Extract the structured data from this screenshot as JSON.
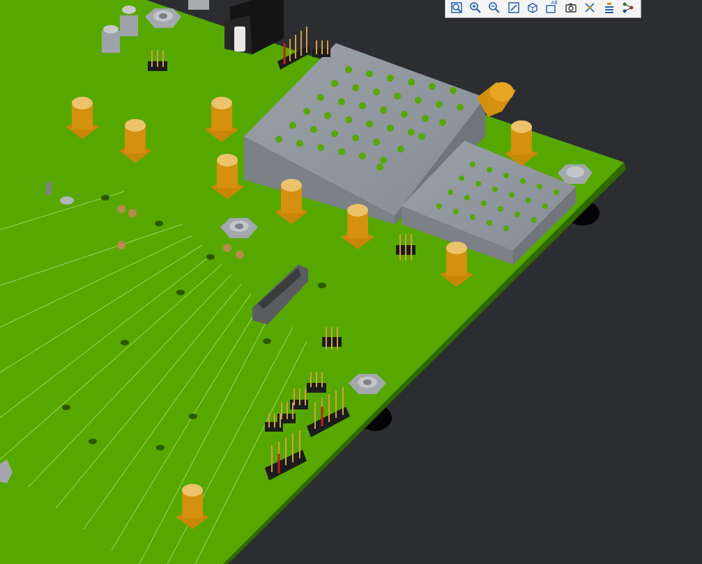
{
  "app": {
    "view": "PCB 3D view"
  },
  "colors": {
    "background": "#2b2d30",
    "board": "#56a800",
    "board_edge": "#2f6a00",
    "shield": "#8f969d",
    "sma_gold": "#d4900e",
    "header_black": "#1c1c1c"
  },
  "toolbar": {
    "buttons": [
      {
        "icon": "zoom-fit-icon"
      },
      {
        "icon": "zoom-in-icon"
      },
      {
        "icon": "zoom-out-icon"
      },
      {
        "icon": "zoom-area-icon"
      },
      {
        "icon": "view-cube-icon"
      },
      {
        "icon": "label-view-icon",
        "label": "AB"
      },
      {
        "icon": "snapshot-icon"
      },
      {
        "icon": "explode-icon"
      },
      {
        "icon": "layer-stack-icon"
      },
      {
        "icon": "net-tree-icon"
      }
    ]
  }
}
